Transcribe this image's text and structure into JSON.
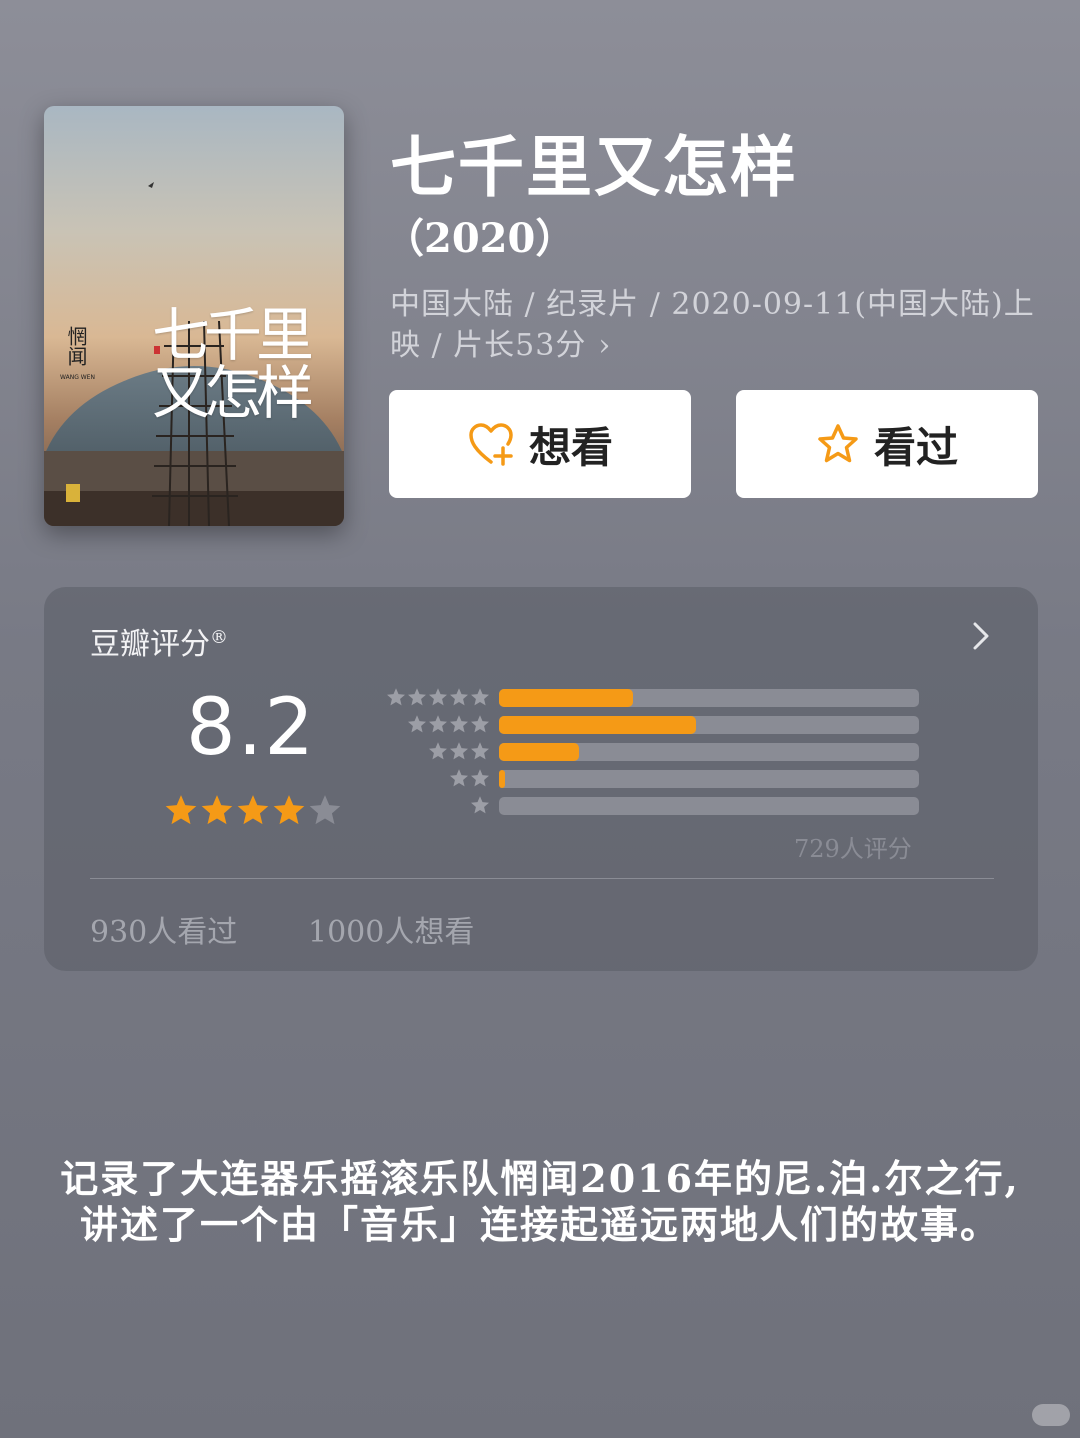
{
  "poster": {
    "title_art": "七千里又怎样",
    "seal_text": "惘闻",
    "seal_sub": "WANG WEN"
  },
  "movie": {
    "title": "七千里又怎样",
    "year": "（2020）",
    "meta": "中国大陆  /  纪录片  /  2020-09-11(中国大陆)上映  /  片长53分",
    "meta_chevron": "›"
  },
  "actions": {
    "want_label": "想看",
    "seen_label": "看过",
    "want_icon": "heart-plus-icon",
    "seen_icon": "star-outline-icon",
    "icon_color": "#f59a16"
  },
  "rating": {
    "title": "豆瓣评分",
    "title_mark": "®",
    "score": "8.2",
    "stars_filled": 4,
    "stars_total": 5,
    "distribution": [
      {
        "stars": 5,
        "fraction": 0.32
      },
      {
        "stars": 4,
        "fraction": 0.47
      },
      {
        "stars": 3,
        "fraction": 0.19
      },
      {
        "stars": 2,
        "fraction": 0.014
      },
      {
        "stars": 1,
        "fraction": 0.0
      }
    ],
    "count_text": "729人评分",
    "seen_text": "930人看过",
    "want_text": "1000人想看",
    "star_color": "#f59a16",
    "bar_color": "#f59a16"
  },
  "caption": {
    "line1": "记录了大连器乐摇滚乐队惘闻2016年的尼.泊.尔之行,",
    "line2": "讲述了一个由「音乐」连接起遥远两地人们的故事。"
  }
}
